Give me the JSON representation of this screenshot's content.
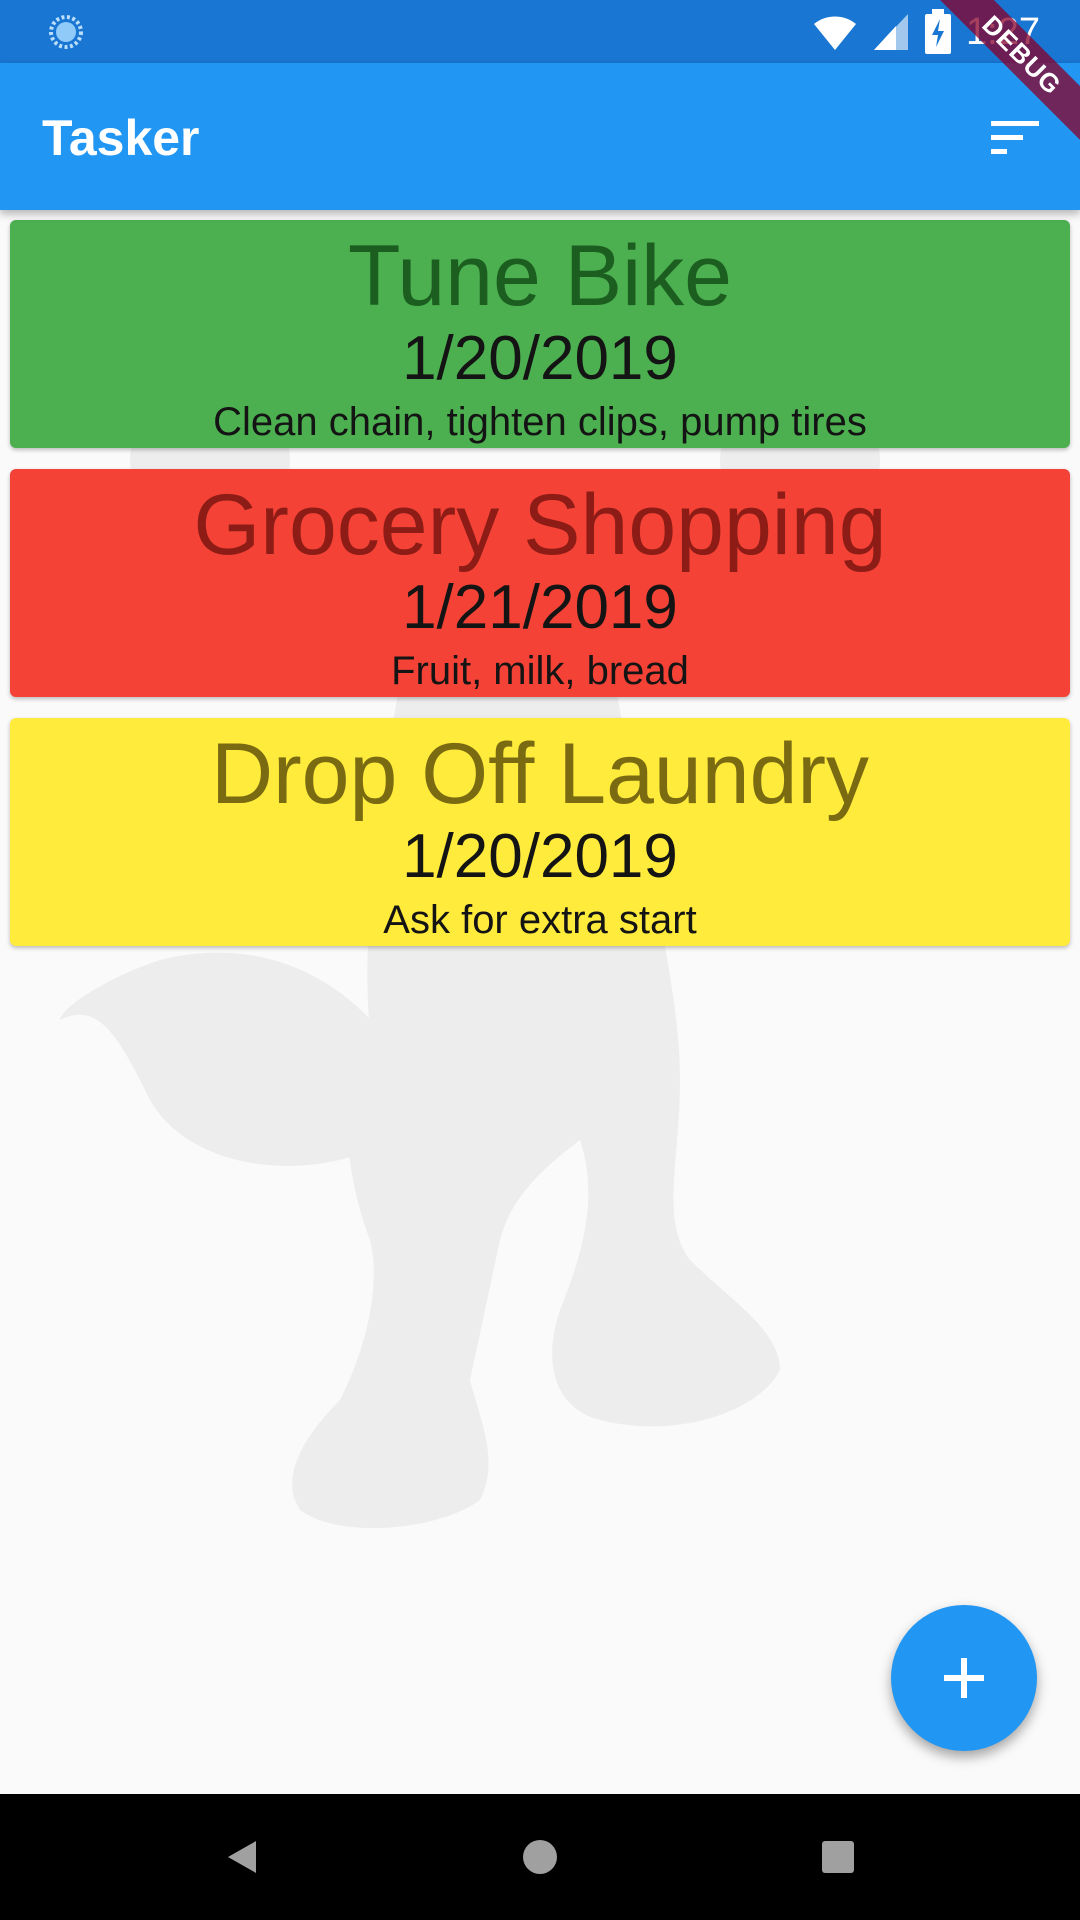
{
  "status_bar": {
    "time": "1:27",
    "loader_icon": "loading-circle-icon",
    "wifi_icon": "wifi-icon",
    "signal_icon": "cell-signal-icon",
    "battery_icon": "battery-charging-icon",
    "background": "#1976d2"
  },
  "debug_banner": {
    "label": "DEBUG"
  },
  "app_bar": {
    "title": "Tasker",
    "sort_icon": "sort-icon",
    "background": "#2196f3"
  },
  "tasks": [
    {
      "title": "Tune Bike",
      "date": "1/20/2019",
      "description": "Clean chain, tighten clips, pump tires",
      "color": "#4caf50",
      "title_color": "#1b5e20"
    },
    {
      "title": "Grocery Shopping",
      "date": "1/21/2019",
      "description": "Fruit, milk, bread",
      "color": "#f44336",
      "title_color": "#8e1c16"
    },
    {
      "title": "Drop Off Laundry",
      "date": "1/20/2019",
      "description": "Ask for extra start",
      "color": "#ffeb3b",
      "title_color": "#7a6b12"
    }
  ],
  "fab": {
    "icon": "plus-icon",
    "color": "#2196f3"
  },
  "nav_bar": {
    "back_icon": "back-triangle-icon",
    "home_icon": "home-circle-icon",
    "recents_icon": "recents-square-icon"
  }
}
